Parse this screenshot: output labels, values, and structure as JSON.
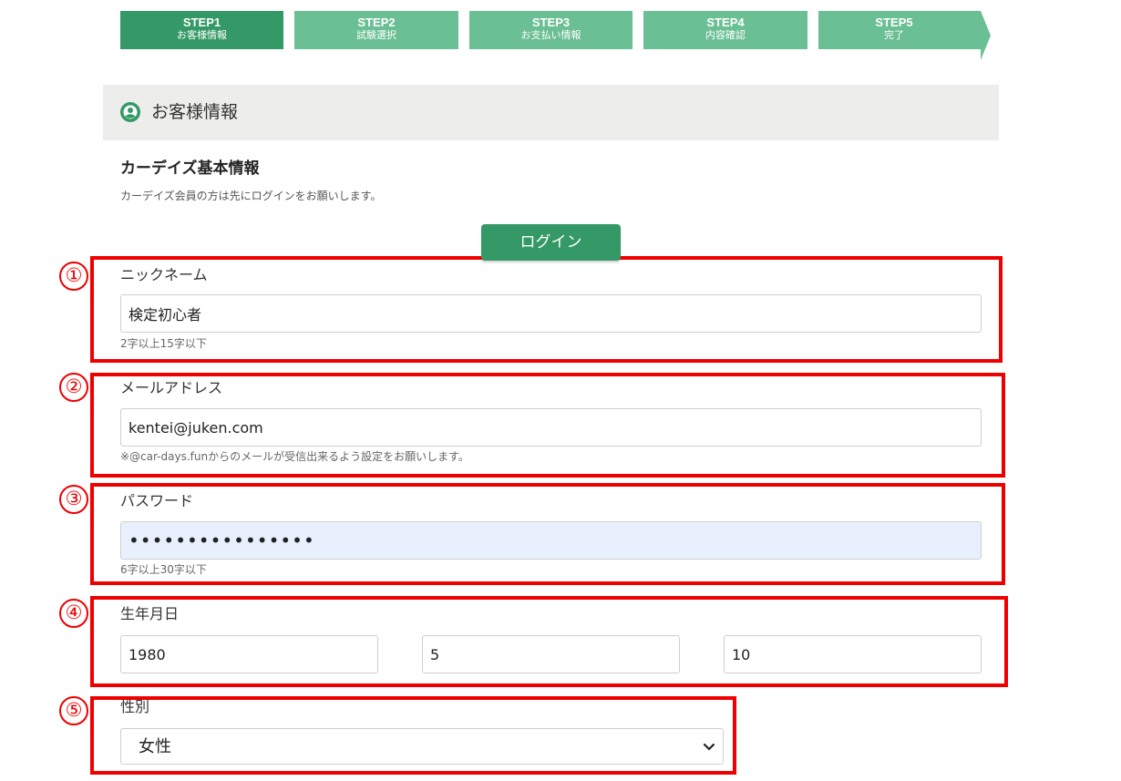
{
  "steps": [
    {
      "num": "STEP1",
      "name": "お客様情報"
    },
    {
      "num": "STEP2",
      "name": "試験選択"
    },
    {
      "num": "STEP3",
      "name": "お支払い情報"
    },
    {
      "num": "STEP4",
      "name": "内容確認"
    },
    {
      "num": "STEP5",
      "name": "完了"
    }
  ],
  "section": {
    "title": "お客様情報",
    "icon": "user-circle-icon"
  },
  "basic": {
    "heading": "カーデイズ基本情報",
    "note": "カーデイズ会員の方は先にログインをお願いします。",
    "login_label": "ログイン"
  },
  "markers": [
    "①",
    "②",
    "③",
    "④",
    "⑤"
  ],
  "form": {
    "nickname": {
      "label": "ニックネーム",
      "value": "検定初心者",
      "hint": "2字以上15字以下"
    },
    "email": {
      "label": "メールアドレス",
      "value": "kentei@juken.com",
      "hint": "※@car-days.funからのメールが受信出来るよう設定をお願いします。"
    },
    "password": {
      "label": "パスワード",
      "value": "••••••••••••••••",
      "hint": "6字以上30字以下"
    },
    "birthday": {
      "label": "生年月日",
      "year": "1980",
      "month": "5",
      "day": "10"
    },
    "gender": {
      "label": "性別",
      "selected": "女性"
    }
  },
  "colors": {
    "accent": "#349966",
    "step_inactive": "#6bbf94",
    "annotation": "#ef0000",
    "autofill": "#e8f0fe"
  }
}
